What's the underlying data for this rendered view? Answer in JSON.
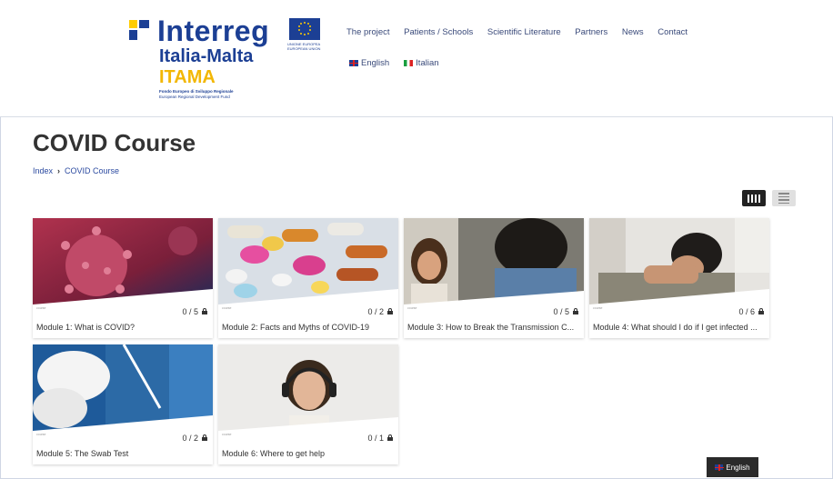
{
  "logo": {
    "brand": "Interreg",
    "region": "Italia-Malta",
    "project": "ITAMA",
    "fund_line1": "Fondo Europeo di Sviluppo Regionale",
    "fund_line2": "European Regional Development Fund",
    "eu_text": "UNIONE EUROPEA EUROPEAN UNION"
  },
  "nav": {
    "items": [
      "The project",
      "Patients / Schools",
      "Scientific Literature",
      "Partners",
      "News",
      "Contact"
    ]
  },
  "languages": {
    "english": "English",
    "italian": "Italian"
  },
  "page": {
    "title": "COVID Course"
  },
  "breadcrumb": {
    "index": "Index",
    "current": "COVID Course"
  },
  "modules": [
    {
      "label": "Module 1: What is COVID?",
      "progress": "0 / 5",
      "tag": "course"
    },
    {
      "label": "Module 2: Facts and Myths of COVID-19",
      "progress": "0 / 2",
      "tag": "course"
    },
    {
      "label": "Module 3: How to Break the Transmission C...",
      "progress": "0 / 5",
      "tag": "course"
    },
    {
      "label": "Module 4: What should I do if I get infected ...",
      "progress": "0 / 6",
      "tag": "course"
    },
    {
      "label": "Module 5: The Swab Test",
      "progress": "0 / 2",
      "tag": "course"
    },
    {
      "label": "Module 6: Where to get help",
      "progress": "0 / 1",
      "tag": "course"
    }
  ],
  "footer": {
    "language": "English"
  },
  "colors": {
    "brand_blue": "#1c3f94",
    "brand_yellow": "#f2b705"
  }
}
